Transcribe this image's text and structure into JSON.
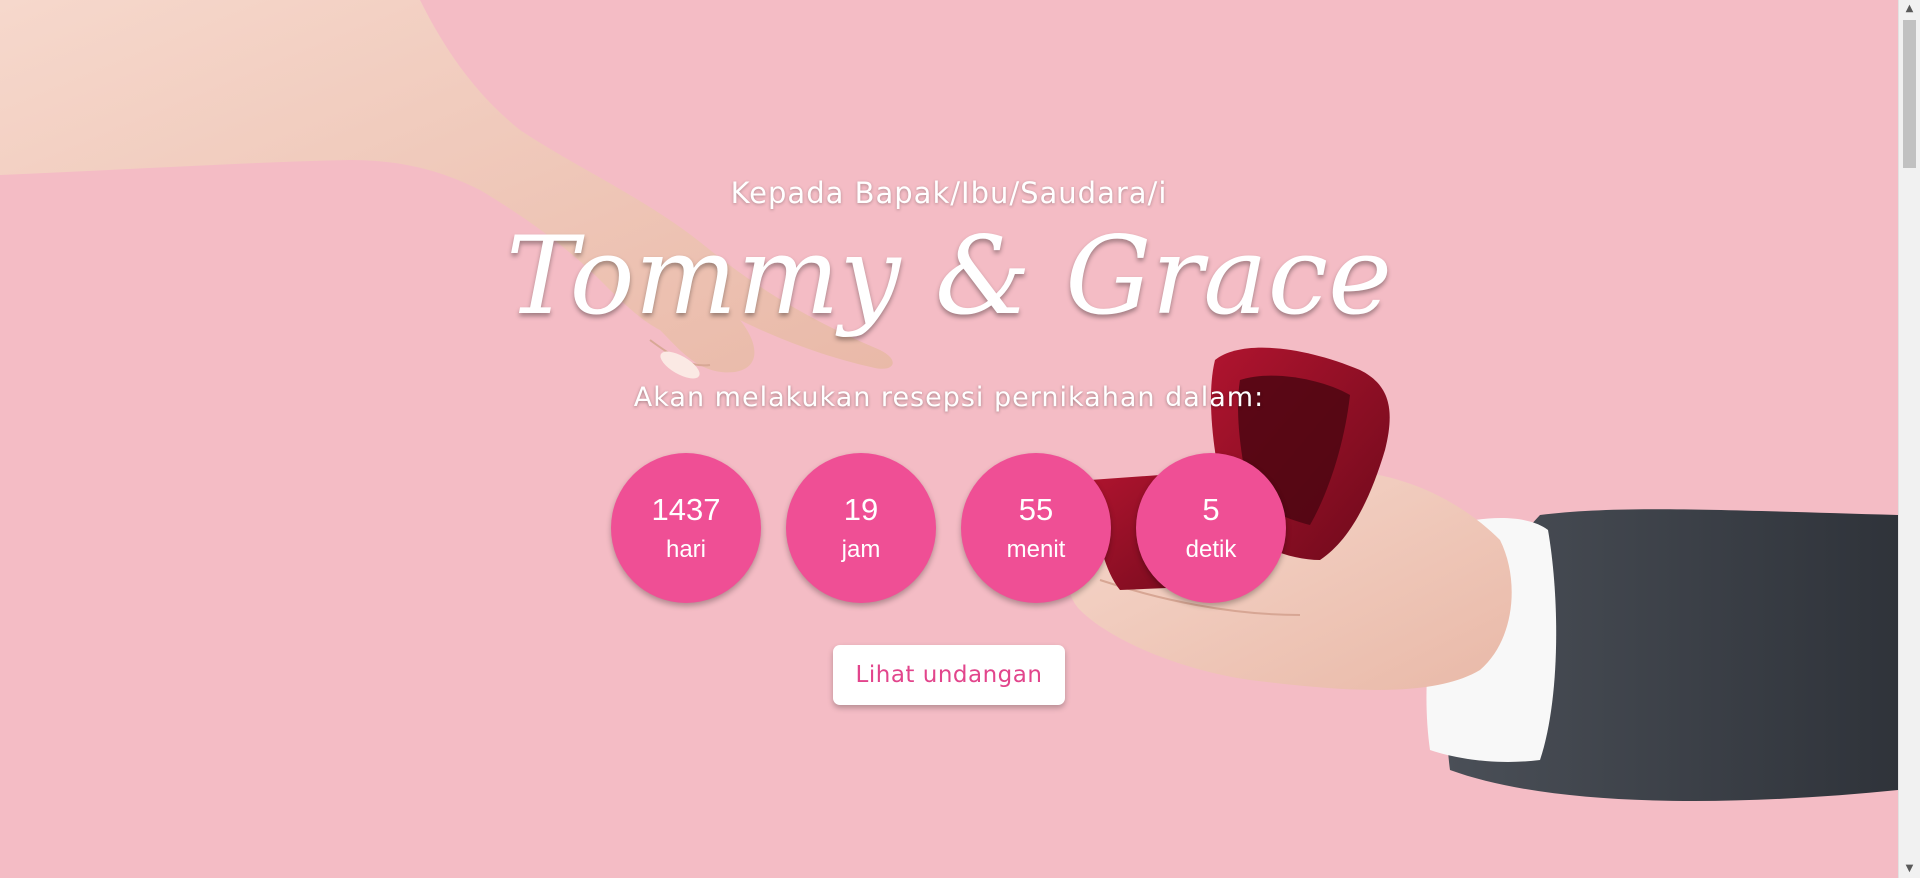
{
  "hero": {
    "greeting": "Kepada Bapak/Ibu/Saudara/i",
    "couple_names": "Tommy & Grace",
    "subtitle": "Akan melakukan resepsi pernikahan dalam:"
  },
  "countdown": [
    {
      "value": "1437",
      "unit": "hari"
    },
    {
      "value": "19",
      "unit": "jam"
    },
    {
      "value": "55",
      "unit": "menit"
    },
    {
      "value": "5",
      "unit": "detik"
    }
  ],
  "cta": {
    "label": "Lihat undangan"
  },
  "colors": {
    "background": "#f4bcc5",
    "accent_pink": "#ef4f95",
    "button_text": "#e2458c",
    "ring_box": "#8e0f24"
  },
  "scrollbar": {
    "up_icon": "scroll-up-arrow-icon",
    "down_icon": "scroll-down-arrow-icon"
  }
}
